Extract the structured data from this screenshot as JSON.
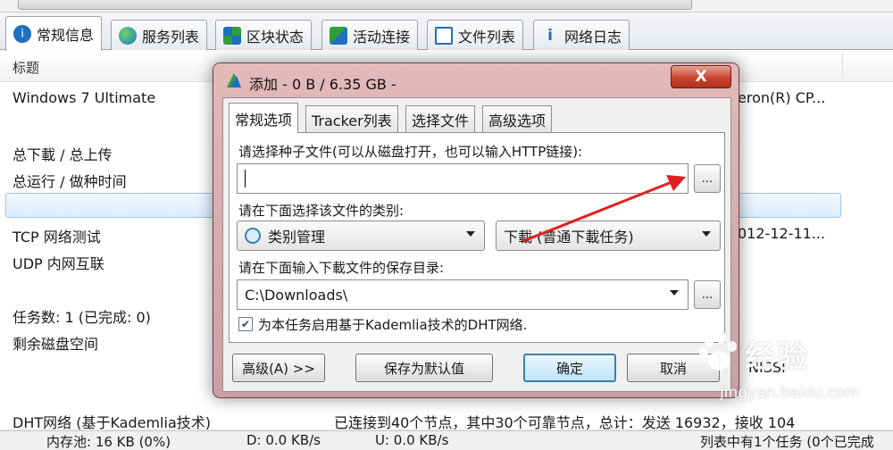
{
  "tabs": [
    {
      "label": "常规信息",
      "icon": "info-icon"
    },
    {
      "label": "服务列表",
      "icon": "globe-icon"
    },
    {
      "label": "区块状态",
      "icon": "blocks-icon"
    },
    {
      "label": "活动连接",
      "icon": "connections-icon"
    },
    {
      "label": "文件列表",
      "icon": "file-list-icon"
    },
    {
      "label": "网络日志",
      "icon": "info-small-icon"
    }
  ],
  "panel": {
    "column_header": "标题",
    "rows": [
      {
        "label": "Windows 7 Ultimate",
        "value": "eron(R) CP..."
      },
      {
        "label": "总下載 / 总上传",
        "value": ""
      },
      {
        "label": "总运行 / 做种时间",
        "value": ""
      },
      {
        "label": "TCP 网络测试",
        "value": "012-12-11..."
      },
      {
        "label": "UDP 内网互联",
        "value": ""
      },
      {
        "label": "任务数: 1 (已完成: 0)",
        "value": ""
      },
      {
        "label": "剩余磁盘空间",
        "value": ""
      },
      {
        "label": "DHT网络 (基于Kademlia技术)",
        "value": "已连接到40个节点，其中30个可靠节点，总计：发送 16932，接收 104"
      }
    ],
    "partial_value": "NISSI"
  },
  "statusbar": {
    "mem": "内存池: 16 KB (0%)",
    "down": "D: 0.0 KB/s",
    "up": "U: 0.0 KB/s",
    "tasks": "列表中有1个任务 (0个已完成"
  },
  "dialog": {
    "title": "添加 - 0 B / 6.35 GB -",
    "close_label": "X",
    "tabs": [
      "常规选项",
      "Tracker列表",
      "选择文件",
      "高级选项"
    ],
    "torrent_label": "请选择种子文件(可以从磁盘打开，也可以输入HTTP链接):",
    "torrent_value": "",
    "browse_label": "...",
    "category_label": "请在下面选择该文件的类别:",
    "category_value": "类别管理",
    "download_type_value": "下載 (普通下載任务)",
    "save_dir_label": "请在下面输入下載文件的保存目录:",
    "save_dir_value": "C:\\Downloads\\",
    "dht_check_label": "为本任务启用基于Kademlia技术的DHT网络.",
    "dht_checked": true,
    "buttons": {
      "advanced": "高级(A) >>",
      "save_default": "保存为默认值",
      "ok": "确定",
      "cancel": "取消"
    }
  },
  "watermark": {
    "brand": "经验",
    "url": "jingyan.baidu.com"
  },
  "colors": {
    "accent_blue": "#1a6fc4",
    "arrow_red": "#e0201f",
    "close_red": "#c8442e"
  }
}
